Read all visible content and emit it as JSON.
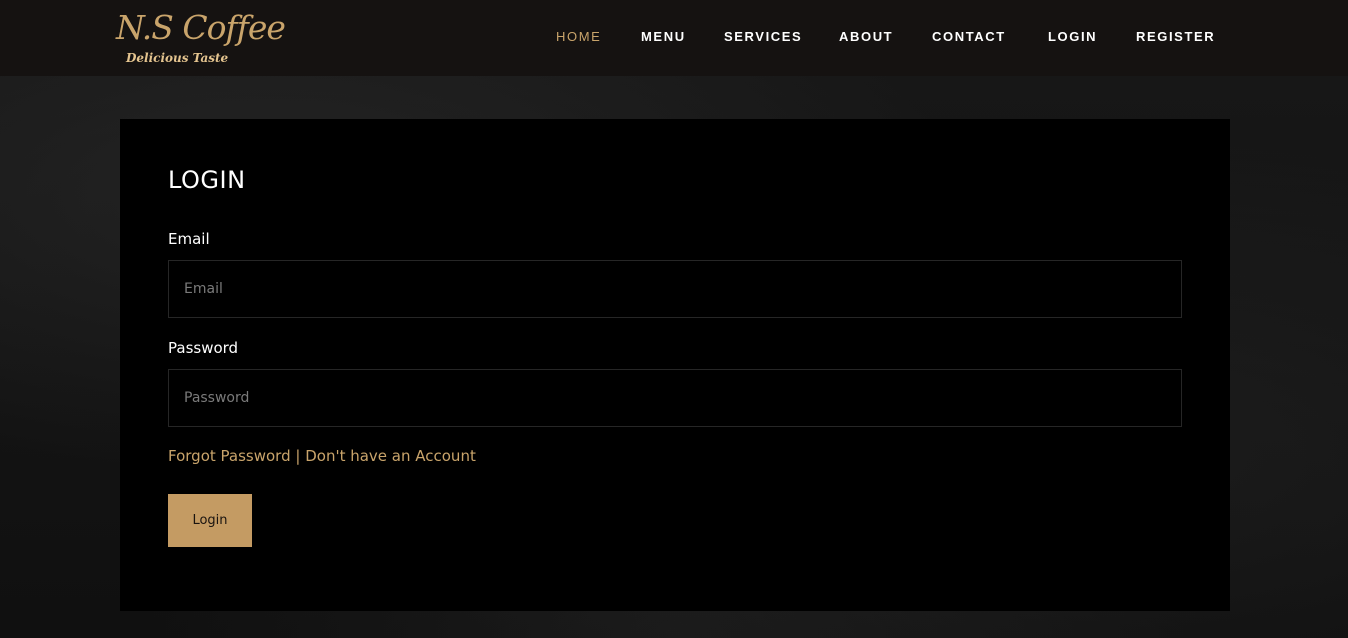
{
  "brand": {
    "name": "N.S Coffee",
    "tagline": "Delicious Taste",
    "accent_color": "#c9a46b"
  },
  "nav": {
    "items": [
      {
        "label": "HOME",
        "active": true
      },
      {
        "label": "MENU",
        "active": false
      },
      {
        "label": "SERVICES",
        "active": false
      },
      {
        "label": "ABOUT",
        "active": false
      },
      {
        "label": "CONTACT",
        "active": false
      },
      {
        "label": "LOGIN",
        "active": false
      },
      {
        "label": "REGISTER",
        "active": false
      }
    ]
  },
  "login": {
    "title": "LOGIN",
    "email_label": "Email",
    "email_placeholder": "Email",
    "email_value": "",
    "password_label": "Password",
    "password_placeholder": "Password",
    "password_value": "",
    "forgot_link": "Forgot Password",
    "separator": "|",
    "register_link": "Don't have an Account",
    "button_label": "Login",
    "button_color": "#c49b63"
  }
}
